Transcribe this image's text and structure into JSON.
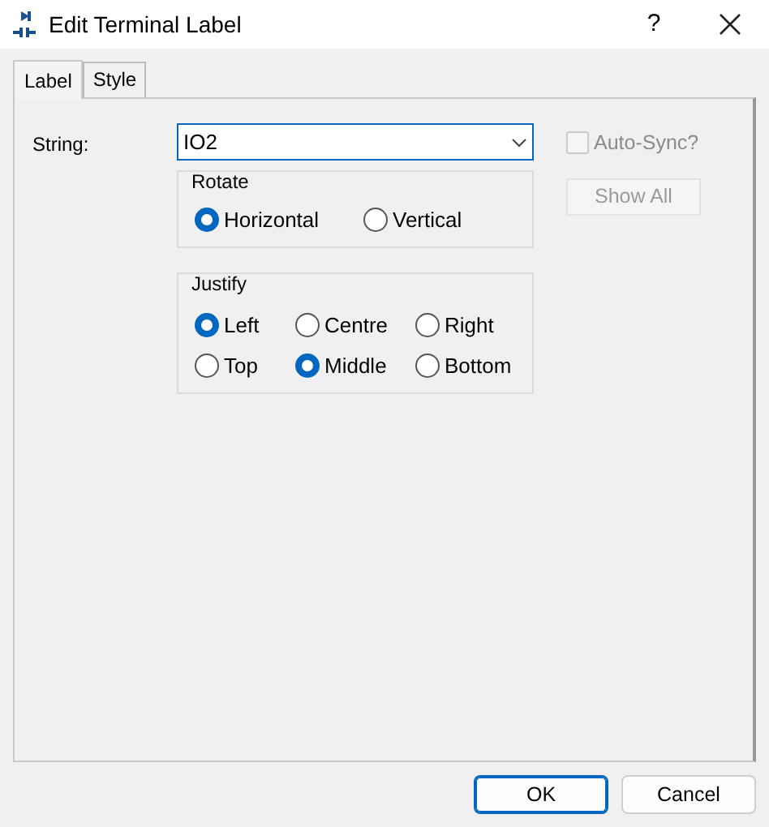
{
  "window": {
    "title": "Edit Terminal Label",
    "help": "?"
  },
  "tabs": [
    {
      "label": "Label",
      "selected": true
    },
    {
      "label": "Style",
      "selected": false
    }
  ],
  "string": {
    "label": "String:",
    "value": "IO2"
  },
  "auto_sync": {
    "label": "Auto-Sync?",
    "checked": false,
    "disabled": true
  },
  "rotate": {
    "title": "Rotate",
    "options": [
      {
        "label": "Horizontal",
        "selected": true
      },
      {
        "label": "Vertical",
        "selected": false
      }
    ]
  },
  "show_all": {
    "label": "Show All",
    "disabled": true
  },
  "justify": {
    "title": "Justify",
    "options": [
      {
        "label": "Left",
        "selected": true
      },
      {
        "label": "Centre",
        "selected": false
      },
      {
        "label": "Right",
        "selected": false
      },
      {
        "label": "Top",
        "selected": false
      },
      {
        "label": "Middle",
        "selected": true
      },
      {
        "label": "Bottom",
        "selected": false
      }
    ]
  },
  "buttons": [
    {
      "label": "OK",
      "default": true
    },
    {
      "label": "Cancel",
      "default": false
    }
  ]
}
